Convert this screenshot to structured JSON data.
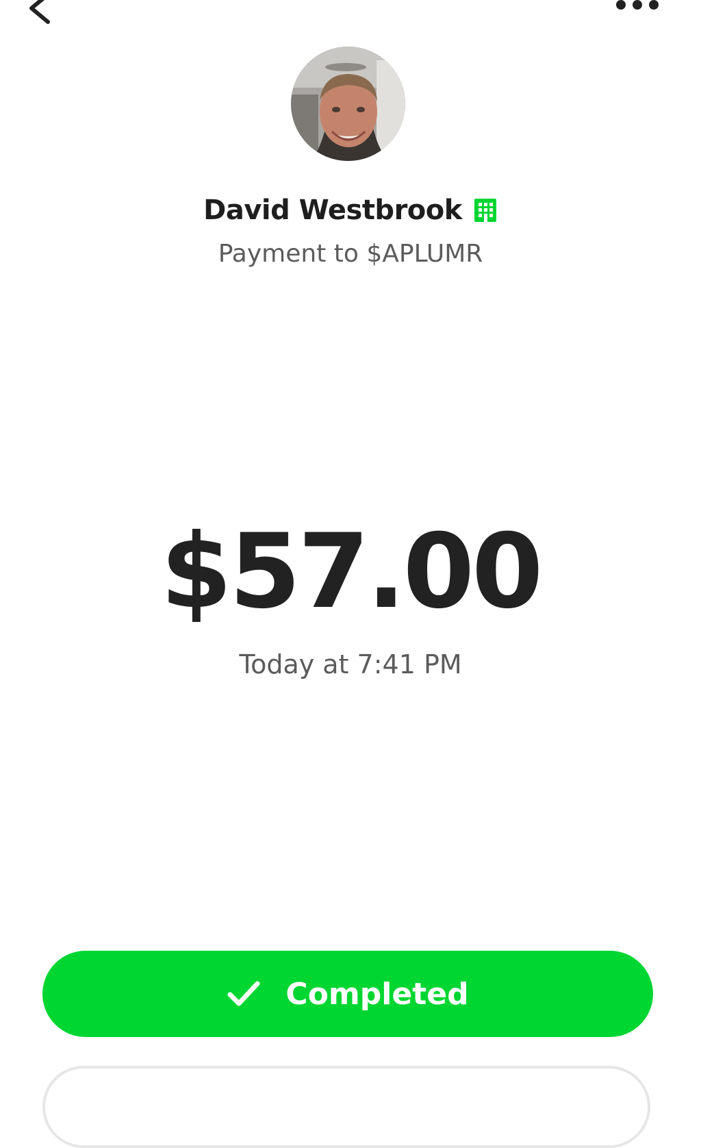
{
  "header": {
    "back_icon": "chevron-left-icon",
    "more_icon": "more-horizontal-icon"
  },
  "recipient": {
    "avatar": "profile-photo",
    "name": "David Westbrook",
    "badge_icon": "business-building-icon",
    "badge_color": "#00d632"
  },
  "payment": {
    "subtitle": "Payment to $APLUMR",
    "amount": "$57.00",
    "timestamp": "Today at 7:41 PM"
  },
  "status": {
    "icon": "checkmark-icon",
    "label": "Completed",
    "color": "#00d632"
  }
}
